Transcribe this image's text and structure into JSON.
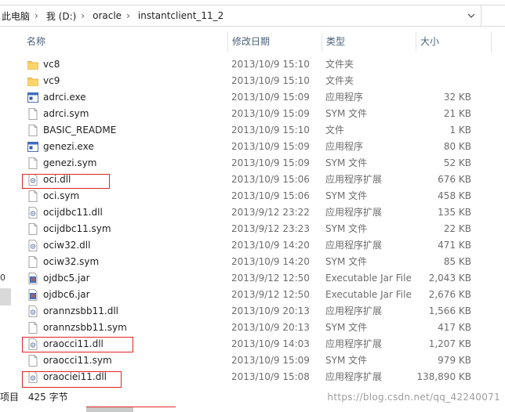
{
  "breadcrumb": [
    "此电脑",
    "我 (D:)",
    "oracle",
    "instantclient_11_2"
  ],
  "columns": {
    "name": "名称",
    "date": "修改日期",
    "type": "类型",
    "size": "大小"
  },
  "left_marker": "0",
  "files": [
    {
      "name": "vc8",
      "date": "2013/10/9 15:10",
      "type": "文件夹",
      "size": "",
      "icon": "folder-icon"
    },
    {
      "name": "vc9",
      "date": "2013/10/9 15:10",
      "type": "文件夹",
      "size": "",
      "icon": "folder-icon"
    },
    {
      "name": "adrci.exe",
      "date": "2013/10/9 15:09",
      "type": "应用程序",
      "size": "32 KB",
      "icon": "exe-icon"
    },
    {
      "name": "adrci.sym",
      "date": "2013/10/9 15:09",
      "type": "SYM 文件",
      "size": "21 KB",
      "icon": "file-icon"
    },
    {
      "name": "BASIC_README",
      "date": "2013/10/9 15:10",
      "type": "文件",
      "size": "1 KB",
      "icon": "file-icon"
    },
    {
      "name": "genezi.exe",
      "date": "2013/10/9 15:09",
      "type": "应用程序",
      "size": "80 KB",
      "icon": "exe-icon"
    },
    {
      "name": "genezi.sym",
      "date": "2013/10/9 15:09",
      "type": "SYM 文件",
      "size": "52 KB",
      "icon": "file-icon"
    },
    {
      "name": "oci.dll",
      "date": "2013/10/9 15:06",
      "type": "应用程序扩展",
      "size": "676 KB",
      "icon": "dll-icon"
    },
    {
      "name": "oci.sym",
      "date": "2013/10/9 15:06",
      "type": "SYM 文件",
      "size": "458 KB",
      "icon": "file-icon"
    },
    {
      "name": "ocijdbc11.dll",
      "date": "2013/9/12 23:22",
      "type": "应用程序扩展",
      "size": "135 KB",
      "icon": "dll-icon"
    },
    {
      "name": "ocijdbc11.sym",
      "date": "2013/9/12 23:23",
      "type": "SYM 文件",
      "size": "22 KB",
      "icon": "file-icon"
    },
    {
      "name": "ociw32.dll",
      "date": "2013/10/9 14:20",
      "type": "应用程序扩展",
      "size": "471 KB",
      "icon": "dll-icon"
    },
    {
      "name": "ociw32.sym",
      "date": "2013/10/9 14:20",
      "type": "SYM 文件",
      "size": "85 KB",
      "icon": "file-icon"
    },
    {
      "name": "ojdbc5.jar",
      "date": "2013/9/12 12:50",
      "type": "Executable Jar File",
      "size": "2,043 KB",
      "icon": "jar-icon"
    },
    {
      "name": "ojdbc6.jar",
      "date": "2013/9/12 12:50",
      "type": "Executable Jar File",
      "size": "2,676 KB",
      "icon": "jar-icon"
    },
    {
      "name": "orannzsbb11.dll",
      "date": "2013/10/9 20:13",
      "type": "应用程序扩展",
      "size": "1,566 KB",
      "icon": "dll-icon"
    },
    {
      "name": "orannzsbb11.sym",
      "date": "2013/10/9 20:13",
      "type": "SYM 文件",
      "size": "417 KB",
      "icon": "file-icon"
    },
    {
      "name": "oraocci11.dll",
      "date": "2013/10/9 14:03",
      "type": "应用程序扩展",
      "size": "1,207 KB",
      "icon": "dll-icon"
    },
    {
      "name": "oraocci11.sym",
      "date": "2013/10/9 15:09",
      "type": "SYM 文件",
      "size": "979 KB",
      "icon": "file-icon"
    },
    {
      "name": "oraociei11.dll",
      "date": "2013/10/9 15:08",
      "type": "应用程序扩展",
      "size": "138,890 KB",
      "icon": "dll-icon"
    }
  ],
  "status": {
    "items_suffix": "项目",
    "count": "425 字节"
  },
  "watermark": "https://blog.csdn.net/qq_42240071",
  "colors": {
    "highlight": "#e02424",
    "folder": "#f5c453",
    "header_text": "#4c607a"
  }
}
